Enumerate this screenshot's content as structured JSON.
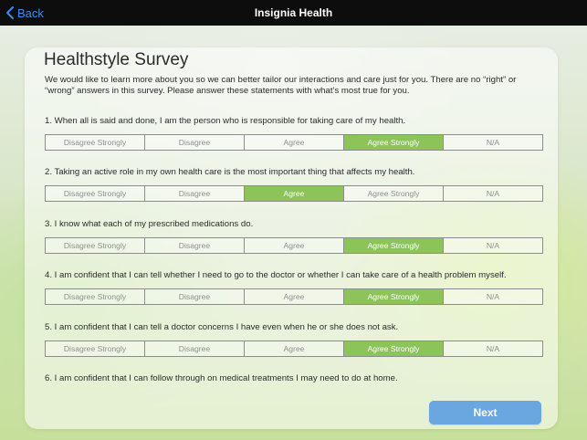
{
  "nav": {
    "back_label": "Back",
    "title": "Insignia Health"
  },
  "survey": {
    "title": "Healthstyle Survey",
    "intro": "We would like to learn more about you so we can better tailor our interactions and care just for you. There are no “right” or “wrong” answers in this survey. Please answer these statements with what’s most true for you.",
    "options": [
      "Disagree Strongly",
      "Disagree",
      "Agree",
      "Agree Strongly",
      "N/A"
    ],
    "questions": [
      {
        "text": "1. When all is said and done, I am the person who is responsible for taking care of my health.",
        "selected": "Agree Strongly"
      },
      {
        "text": "2. Taking an active role in my own health care is the most important thing that affects my health.",
        "selected": "Agree"
      },
      {
        "text": "3. I know what each of my prescribed medications do.",
        "selected": "Agree Strongly"
      },
      {
        "text": "4. I am confident that I can tell whether I need to go to the doctor or whether I can take care of a health problem myself.",
        "selected": "Agree Strongly"
      },
      {
        "text": "5. I am confident that I can tell a doctor concerns I have even when he or she does not ask.",
        "selected": "Agree Strongly"
      },
      {
        "text": "6. I am confident that I can follow through on medical treatments I may need to do at home.",
        "selected": null
      }
    ],
    "next_label": "Next"
  }
}
